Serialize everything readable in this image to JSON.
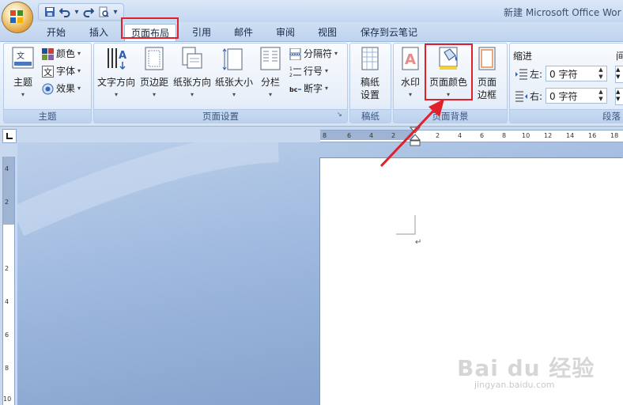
{
  "window": {
    "title": "新建 Microsoft Office Wor"
  },
  "tabs": [
    {
      "label": "开始"
    },
    {
      "label": "插入"
    },
    {
      "label": "页面布局"
    },
    {
      "label": "引用"
    },
    {
      "label": "邮件"
    },
    {
      "label": "审阅"
    },
    {
      "label": "视图"
    },
    {
      "label": "保存到云笔记"
    }
  ],
  "groups": {
    "theme": {
      "label": "主题",
      "theme_button": "主题",
      "colors": "颜色",
      "fonts": "字体",
      "effects": "效果"
    },
    "page_setup": {
      "label": "页面设置",
      "text_direction": "文字方向",
      "margins": "页边距",
      "orientation": "纸张方向",
      "size": "纸张大小",
      "columns": "分栏",
      "breaks": "分隔符",
      "line_numbers": "行号",
      "hyphenation": "断字"
    },
    "manuscript": {
      "label": "稿纸",
      "setup_line1": "稿纸",
      "setup_line2": "设置"
    },
    "page_background": {
      "label": "页面背景",
      "watermark": "水印",
      "page_color": "页面颜色",
      "border_line1": "页面",
      "border_line2": "边框"
    },
    "paragraph": {
      "label": "段落",
      "indent_title": "缩进",
      "left_label": "左:",
      "left_value": "0 字符",
      "right_label": "右:",
      "right_value": "0 字符",
      "spacing_title_partial": "间"
    }
  },
  "ruler_h": [
    "8",
    "6",
    "4",
    "2",
    "2",
    "4",
    "6",
    "8",
    "10",
    "12",
    "14",
    "16",
    "18"
  ],
  "ruler_v": [
    "4",
    "2",
    "2",
    "4",
    "6",
    "8",
    "10"
  ],
  "watermark": {
    "brand": "Bai du 经验",
    "url": "jingyan.baidu.com"
  },
  "colors": {
    "highlight": "#e0202a",
    "ribbon": "#dfe9f7",
    "workspace": "#9fb9df"
  }
}
